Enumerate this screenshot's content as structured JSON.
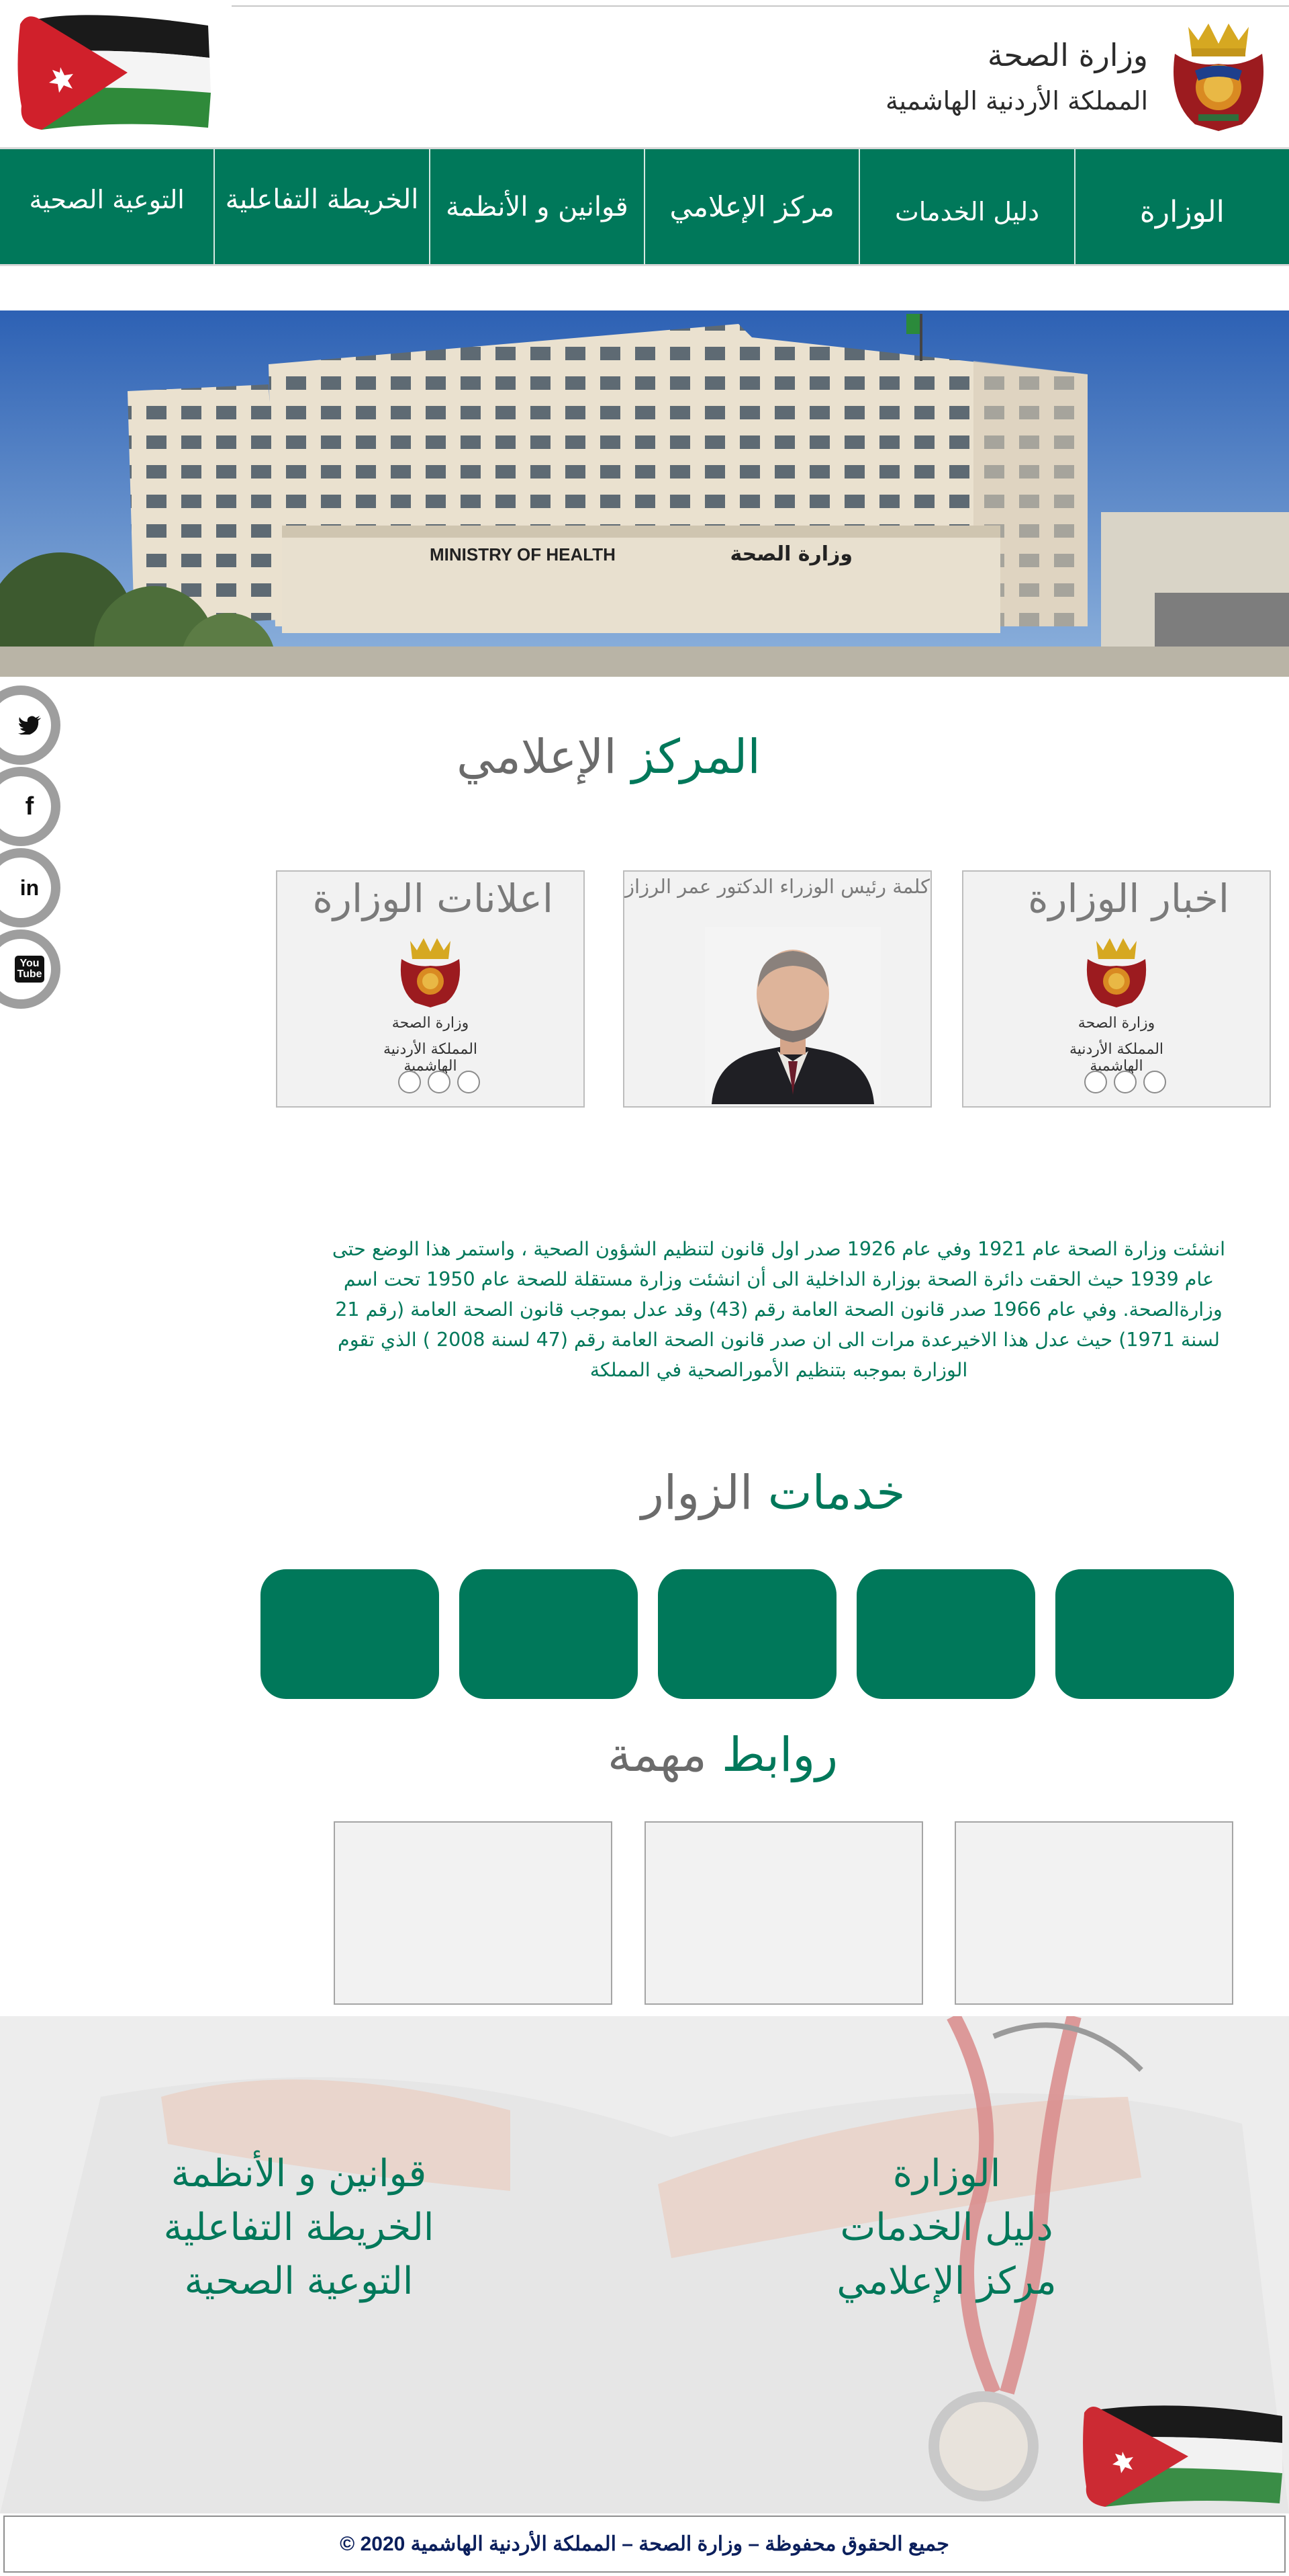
{
  "header": {
    "logo_line1": "وزارة الصحة",
    "logo_line2": "المملكة الأردنية الهاشمية"
  },
  "nav": {
    "items": [
      {
        "label": "الوزارة"
      },
      {
        "label": "دليل الخدمات"
      },
      {
        "label": "مركز الإعلامي"
      },
      {
        "label": "قوانين و الأنظمة"
      },
      {
        "label": "الخريطة التفاعلية"
      },
      {
        "label": "التوعية الصحية"
      }
    ]
  },
  "hero": {
    "sign_english": "MINISTRY OF HEALTH",
    "sign_arabic": "وزارة الصحة"
  },
  "social": [
    {
      "icon": "twitter-icon",
      "glyph": "🐦"
    },
    {
      "icon": "facebook-icon",
      "glyph": "f"
    },
    {
      "icon": "linkedin-icon",
      "glyph": "in"
    },
    {
      "icon": "youtube-icon",
      "glyph": "You\nTube"
    }
  ],
  "media_center": {
    "title_green": "المركز",
    "title_gray": "الإعلامي",
    "cards": {
      "news": {
        "title": "اخبار الوزارة"
      },
      "pm_word": {
        "title": "كلمة رئيس الوزراء الدكتور عمر الرزاز"
      },
      "announcements": {
        "title": "اعلانات الوزارة"
      }
    }
  },
  "about": {
    "text": "انشئت وزارة الصحة عام 1921 وفي عام 1926 صدر اول قانون لتنظيم الشؤون الصحية ، واستمر هذا الوضع حتى عام 1939 حيث الحقت دائرة الصحة بوزارة الداخلية الى أن انشئت وزارة مستقلة للصحة عام 1950 تحت اسم وزارةالصحة. وفي عام 1966 صدر قانون الصحة العامة رقم (43) وقد عدل بموجب قانون الصحة العامة (رقم 21 لسنة 1971) حيث عدل هذا الاخيرعدة مرات الى ان صدر قانون الصحة العامة رقم (47 لسنة 2008 ) الذي تقوم الوزارة بموجبه بتنظيم الأمورالصحية في المملكة"
  },
  "services": {
    "title_green": "خدمات",
    "title_gray": "الزوار"
  },
  "links": {
    "title_green": "روابط",
    "title_gray": "مهمة"
  },
  "footer": {
    "col_right": [
      "الوزارة",
      "دليل الخدمات",
      "مركز الإعلامي"
    ],
    "col_left": [
      "قوانين و الأنظمة",
      "الخريطة التفاعلية",
      "التوعية الصحية"
    ],
    "copyright": "جميع الحقوق محفوظة – وزارة الصحة – المملكة الأردنية الهاشمية 2020 ©"
  },
  "colors": {
    "brand_green": "#00785a",
    "title_gray": "#6b6b6b",
    "card_bg": "#f2f2f2"
  }
}
